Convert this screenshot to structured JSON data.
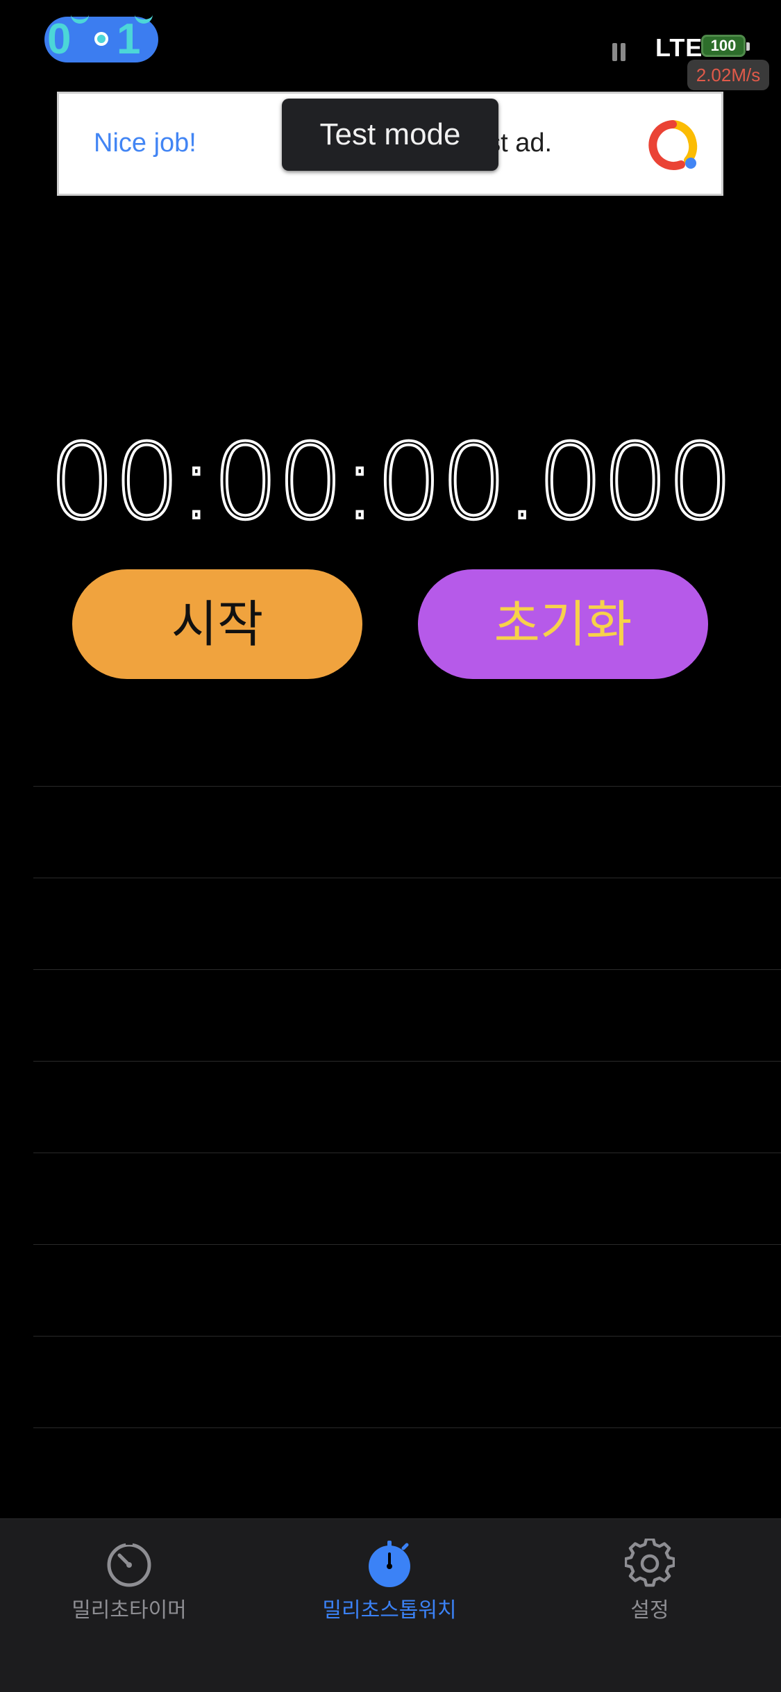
{
  "status_bar": {
    "app_indicator": "0·1",
    "network": "LTE",
    "battery": "100",
    "net_speed": "2.02M/s"
  },
  "ad": {
    "headline": "Nice job!",
    "body_visible": "est ad.",
    "toast": "Test mode"
  },
  "stopwatch": {
    "display": "00:00:00.000"
  },
  "controls": {
    "start_label": "시작",
    "reset_label": "초기화"
  },
  "laps": [],
  "tab_bar": {
    "tabs": [
      {
        "label": "밀리초타이머",
        "icon": "timer-icon",
        "active": false
      },
      {
        "label": "밀리초스톱워치",
        "icon": "stopwatch-icon",
        "active": true
      },
      {
        "label": "설정",
        "icon": "gear-icon",
        "active": false
      }
    ]
  },
  "colors": {
    "start_button": "#f0a33e",
    "reset_button": "#b65ae9",
    "reset_text": "#f7d24a",
    "active_tab": "#3b82f6",
    "inactive_tab": "#8e8e93"
  }
}
